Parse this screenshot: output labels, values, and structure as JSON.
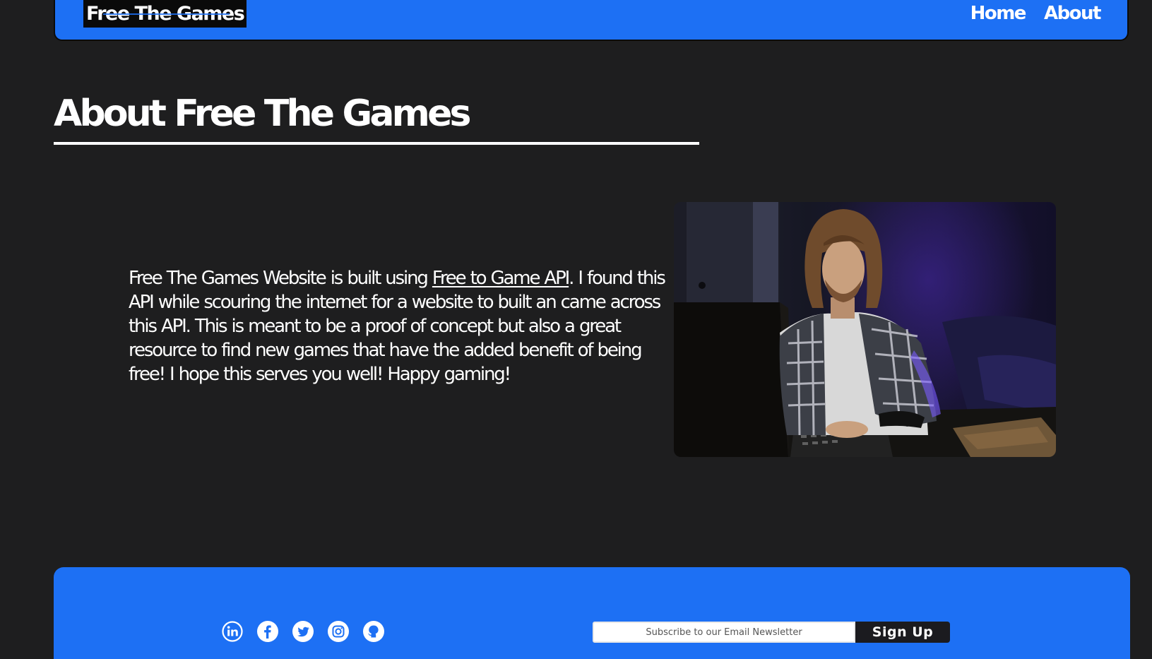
{
  "navbar": {
    "brand": "Free The Games",
    "links": [
      {
        "label": "Home"
      },
      {
        "label": "About"
      }
    ]
  },
  "page": {
    "title": "About Free The Games"
  },
  "about": {
    "text_before_link": "Free The Games Website is built using ",
    "link_label": "Free to Game API",
    "text_after_link": ". I found this API while scouring the internet for a website to built an came across this API. This is meant to be a proof of concept but also a great resource to find new games that have the added benefit of being free! I hope this serves you well! Happy gaming!"
  },
  "photo": {
    "description": "man-gaming-at-computer-photo"
  },
  "footer": {
    "social": [
      {
        "icon": "linkedin-icon"
      },
      {
        "icon": "facebook-icon"
      },
      {
        "icon": "twitter-icon"
      },
      {
        "icon": "instagram-icon"
      },
      {
        "icon": "github-icon"
      }
    ],
    "newsletter": {
      "placeholder": "Subscribe to our Email Newsletter",
      "button_label": "Sign Up"
    }
  },
  "colors": {
    "background": "#1e1e1f",
    "accent_blue": "#1d70f4",
    "text": "#ffffff",
    "button_dark": "#1b1b1f"
  }
}
